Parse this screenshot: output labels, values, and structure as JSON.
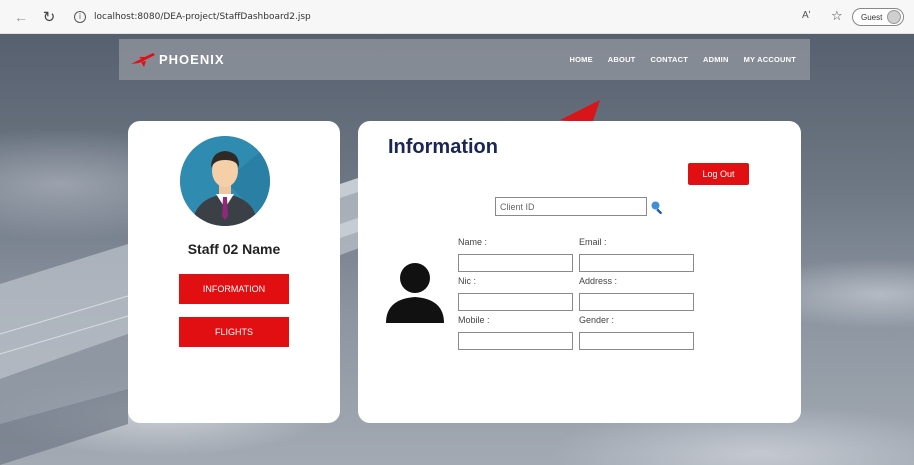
{
  "browser": {
    "url": "localhost:8080/DEA-project/StaffDashboard2.jsp",
    "profile_label": "Guest",
    "read_aloud_label": "Aʹ"
  },
  "topnav": {
    "brand": "PHOENIX",
    "menu": [
      "HOME",
      "ABOUT",
      "CONTACT",
      "ADMIN",
      "MY ACCOUNT"
    ]
  },
  "profile_card": {
    "staff_name": "Staff 02 Name",
    "information_button": "INFORMATION",
    "flights_button": "FLIGHTS"
  },
  "info_card": {
    "title": "Information",
    "logout_label": "Log Out",
    "client_id_placeholder": "Client ID",
    "fields": {
      "name_label": "Name :",
      "email_label": "Email :",
      "nic_label": "Nic :",
      "address_label": "Address :",
      "mobile_label": "Mobile :",
      "gender_label": "Gender :"
    }
  },
  "colors": {
    "accent_red": "#e10f12",
    "title_navy": "#1b2657",
    "avatar_bg": "#2f8bb0"
  },
  "icons": {
    "search": "magnifier-icon",
    "client_photo": "person-silhouette-icon",
    "staff_avatar": "businessman-avatar-icon",
    "logo": "plane-logo-icon"
  }
}
